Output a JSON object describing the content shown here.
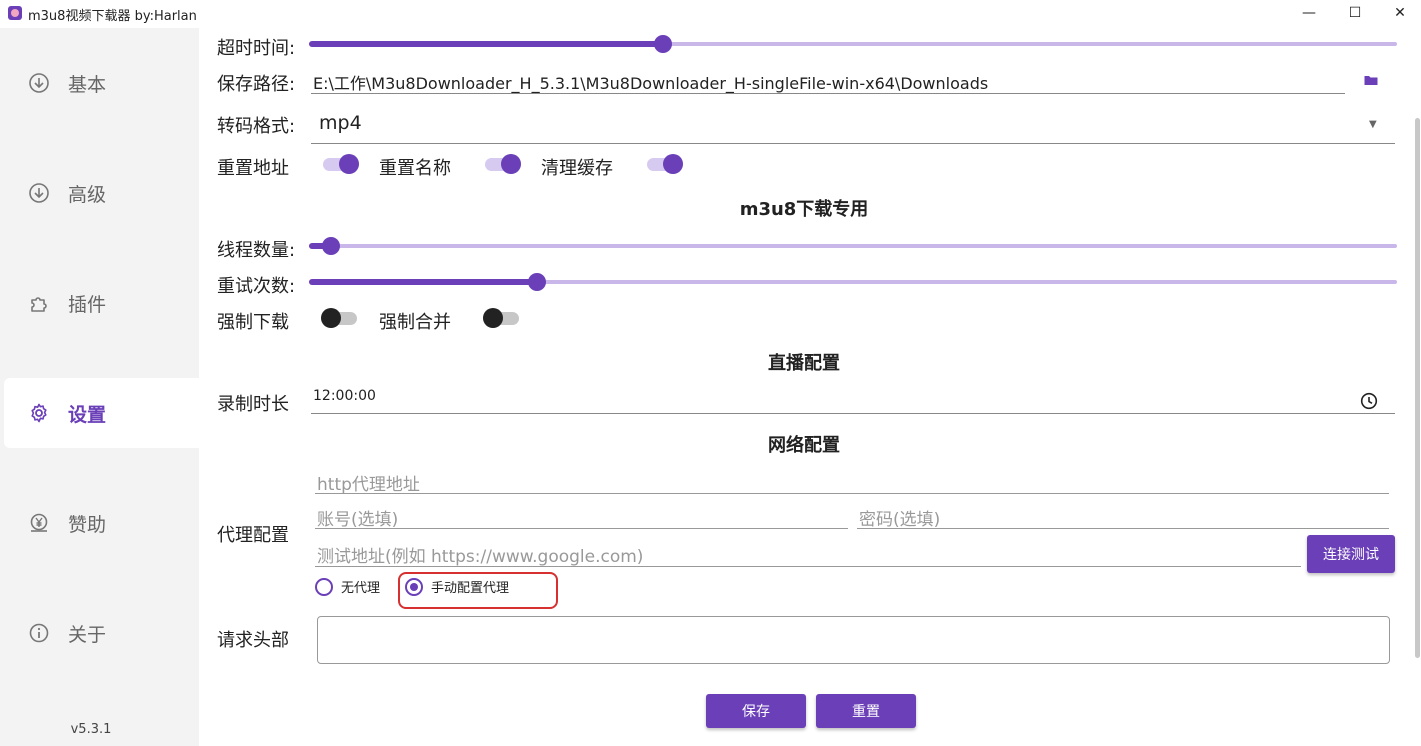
{
  "window": {
    "title": "m3u8视频下载器 by:Harlan",
    "min_symbol": "—",
    "max_symbol": "☐",
    "close_symbol": "✕"
  },
  "sidebar": {
    "items": [
      {
        "label": "基本",
        "icon": "download-circle-icon",
        "active": false
      },
      {
        "label": "高级",
        "icon": "download-circle-icon",
        "active": false
      },
      {
        "label": "插件",
        "icon": "puzzle-icon",
        "active": false
      },
      {
        "label": "设置",
        "icon": "gear-icon",
        "active": true
      },
      {
        "label": "赞助",
        "icon": "yen-coin-icon",
        "active": false
      },
      {
        "label": "关于",
        "icon": "info-icon",
        "active": false
      }
    ],
    "version": "v5.3.1"
  },
  "settings": {
    "timeout_label": "超时时间:",
    "timeout_value": 0.325,
    "save_path_label": "保存路径:",
    "save_path_value": "E:\\工作\\M3u8Downloader_H_5.3.1\\M3u8Downloader_H-singleFile-win-x64\\Downloads",
    "format_label": "转码格式:",
    "format_value": "mp4",
    "reset_url_label": "重置地址",
    "reset_url_on": true,
    "reset_name_label": "重置名称",
    "reset_name_on": true,
    "clear_cache_label": "清理缓存",
    "clear_cache_on": true
  },
  "m3u8": {
    "section_title": "m3u8下载专用",
    "threads_label": "线程数量:",
    "threads_value": 0.02,
    "retries_label": "重试次数:",
    "retries_value": 0.21,
    "force_download_label": "强制下载",
    "force_download_on": false,
    "force_merge_label": "强制合并",
    "force_merge_on": false
  },
  "live": {
    "section_title": "直播配置",
    "record_label": "录制时长",
    "record_value": "12:00:00"
  },
  "network": {
    "section_title": "网络配置",
    "proxy_label": "代理配置",
    "proxy_address_placeholder": "http代理地址",
    "account_placeholder": "账号(选填)",
    "password_placeholder": "密码(选填)",
    "test_url_placeholder": "测试地址(例如 https://www.google.com)",
    "test_button": "连接测试",
    "radio_no_proxy": "无代理",
    "radio_manual_proxy": "手动配置代理",
    "selected": "manual",
    "header_label": "请求头部"
  },
  "actions": {
    "save": "保存",
    "reset": "重置"
  },
  "colors": {
    "accent": "#6a3fb8",
    "accent_light": "#c9b7ea",
    "highlight": "#d63030"
  }
}
